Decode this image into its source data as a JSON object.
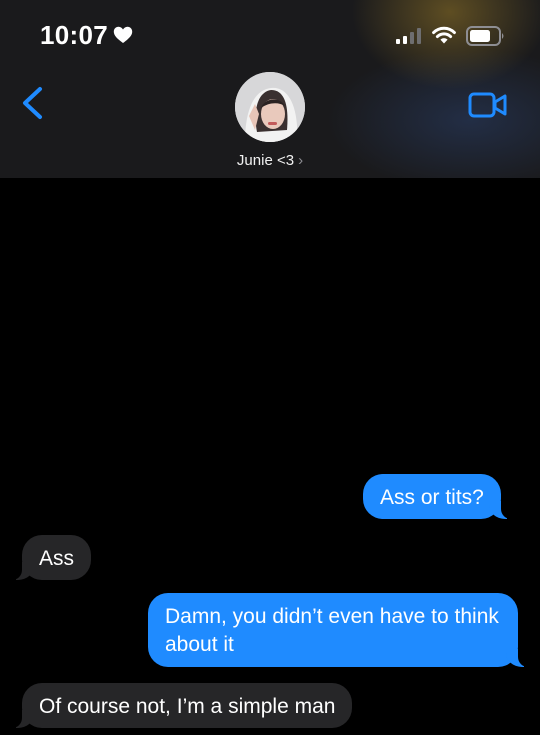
{
  "status_bar": {
    "time": "10:07",
    "heart_icon": "heart-icon",
    "signal_icon": "signal-icon",
    "wifi_icon": "wifi-icon",
    "battery_icon": "battery-icon"
  },
  "header": {
    "contact_name": "Junie <3",
    "chevron": "›",
    "back_icon": "chevron-left-icon",
    "video_icon": "video-camera-icon",
    "accent_color": "#1f8bff"
  },
  "messages": [
    {
      "direction": "sent",
      "text": "Ass or tits?"
    },
    {
      "direction": "received",
      "text": "Ass"
    },
    {
      "direction": "sent",
      "text": "Damn, you didn’t even have to think about it"
    },
    {
      "direction": "received",
      "text": "Of course not, I’m a simple man"
    }
  ],
  "colors": {
    "sent_bubble": "#1f8bff",
    "received_bubble": "#262628",
    "background": "#000000"
  }
}
